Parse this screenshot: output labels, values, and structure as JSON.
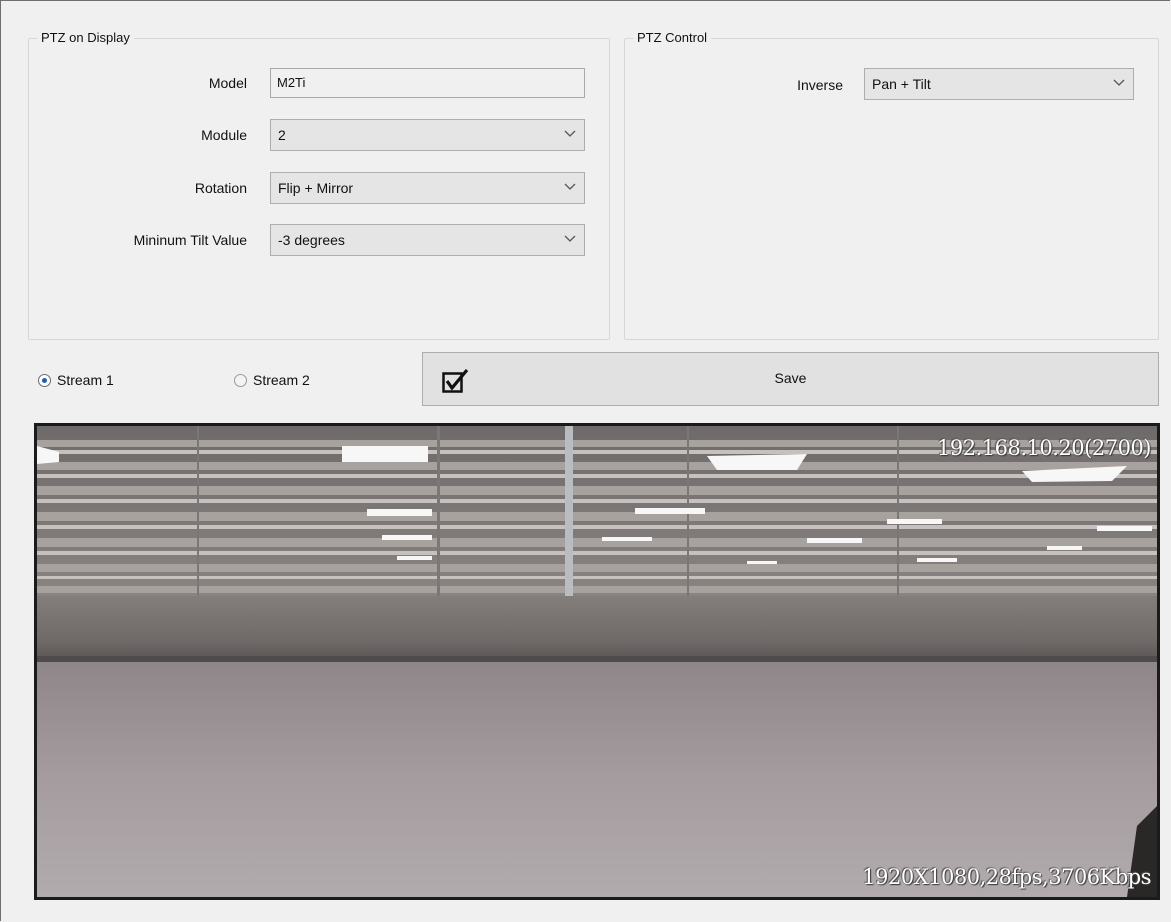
{
  "ptz_display": {
    "title": "PTZ on Display",
    "model_label": "Model",
    "model_value": "M2Ti",
    "module_label": "Module",
    "module_value": "2",
    "rotation_label": "Rotation",
    "rotation_value": "Flip + Mirror",
    "min_tilt_label": "Mininum Tilt Value",
    "min_tilt_value": "-3 degrees"
  },
  "ptz_control": {
    "title": "PTZ Control",
    "inverse_label": "Inverse",
    "inverse_value": "Pan + Tilt"
  },
  "streams": {
    "stream1_label": "Stream 1",
    "stream1_selected": true,
    "stream2_label": "Stream 2",
    "stream2_selected": false
  },
  "save_button": {
    "label": "Save",
    "icon": "checkbox-check-icon"
  },
  "video": {
    "address_overlay": "192.168.10.20(2700)",
    "stats_overlay": "1920X1080,28fps,3706Kbps"
  }
}
